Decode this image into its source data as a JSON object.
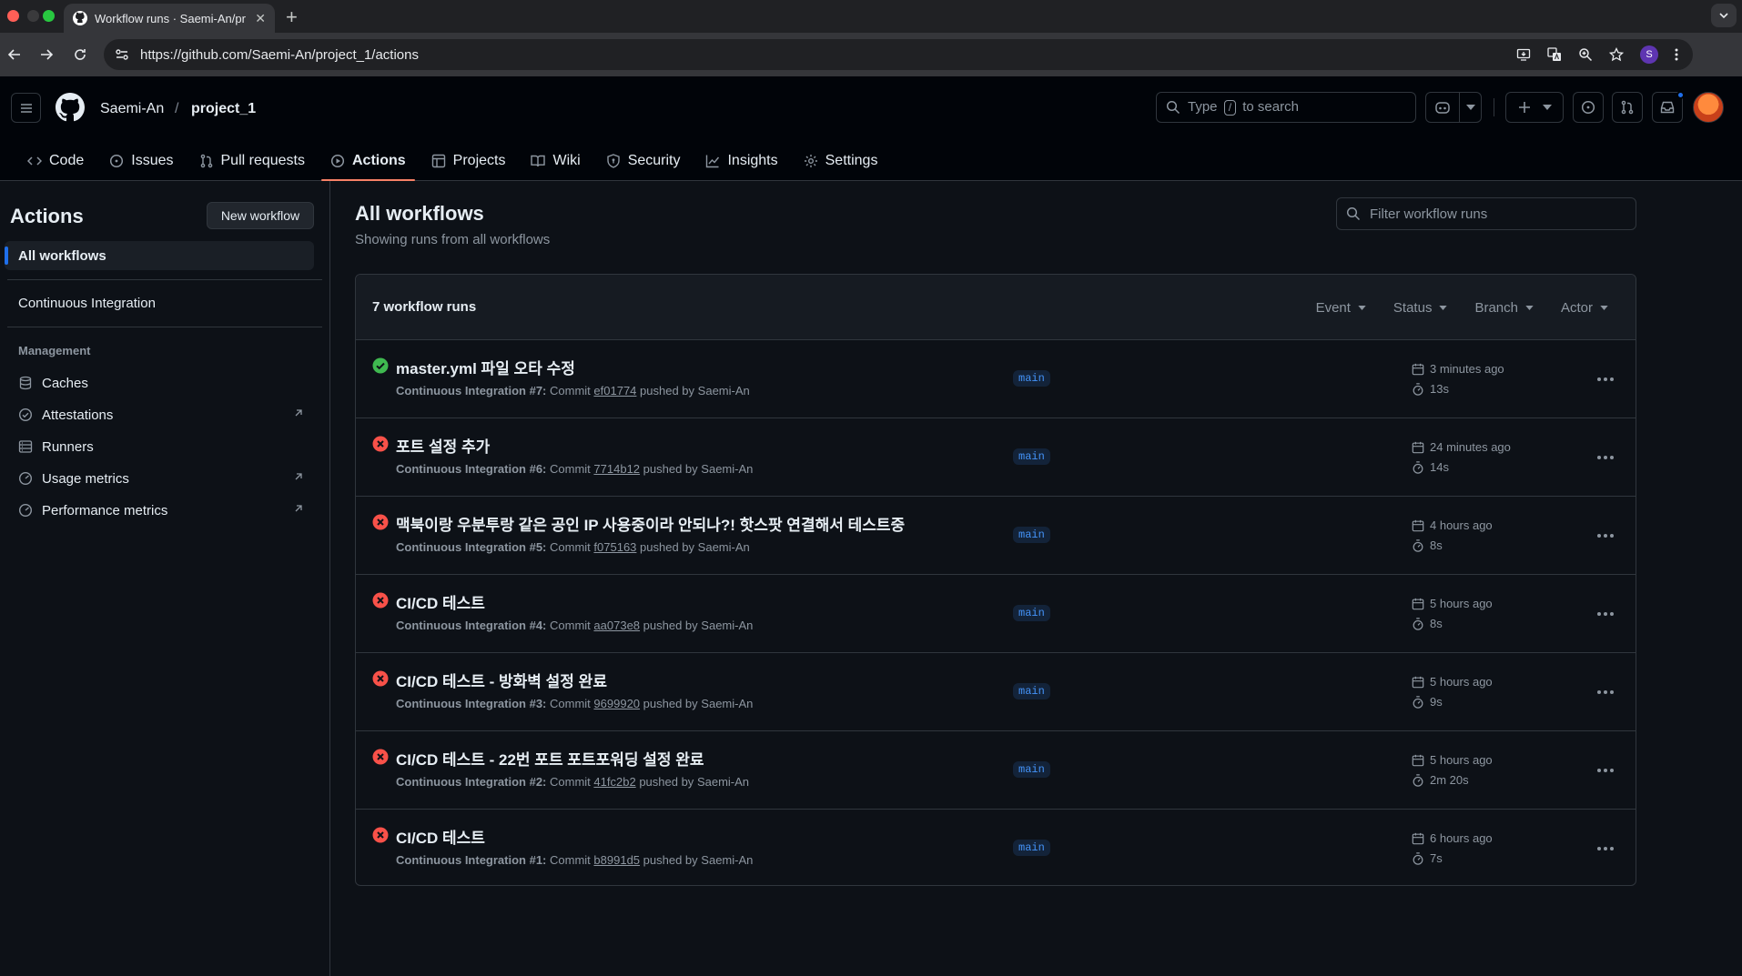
{
  "browser": {
    "tab_title": "Workflow runs · Saemi-An/pr",
    "url": "https://github.com/Saemi-An/project_1/actions",
    "profile_initial": "S"
  },
  "header": {
    "owner": "Saemi-An",
    "separator": "/",
    "repo": "project_1",
    "search_prefix": "Type",
    "search_key": "/",
    "search_suffix": "to search"
  },
  "repo_nav": [
    {
      "label": "Code",
      "icon": "code-icon"
    },
    {
      "label": "Issues",
      "icon": "issue-icon"
    },
    {
      "label": "Pull requests",
      "icon": "pull-request-icon"
    },
    {
      "label": "Actions",
      "icon": "play-icon",
      "active": true
    },
    {
      "label": "Projects",
      "icon": "table-icon"
    },
    {
      "label": "Wiki",
      "icon": "book-icon"
    },
    {
      "label": "Security",
      "icon": "shield-icon"
    },
    {
      "label": "Insights",
      "icon": "graph-icon"
    },
    {
      "label": "Settings",
      "icon": "gear-icon"
    }
  ],
  "sidebar": {
    "title": "Actions",
    "new_workflow_label": "New workflow",
    "all_workflows_label": "All workflows",
    "workflows": [
      "Continuous Integration"
    ],
    "management_label": "Management",
    "management_items": [
      {
        "label": "Caches",
        "icon": "database-icon",
        "external": false
      },
      {
        "label": "Attestations",
        "icon": "verified-icon",
        "external": true
      },
      {
        "label": "Runners",
        "icon": "server-icon",
        "external": false
      },
      {
        "label": "Usage metrics",
        "icon": "meter-icon",
        "external": true
      },
      {
        "label": "Performance metrics",
        "icon": "meter-icon",
        "external": true
      }
    ]
  },
  "main": {
    "title": "All workflows",
    "subtitle": "Showing runs from all workflows",
    "filter_placeholder": "Filter workflow runs",
    "runs_count": "7 workflow runs",
    "filters": [
      "Event",
      "Status",
      "Branch",
      "Actor"
    ],
    "commit_word": "Commit",
    "pushed_by_word": "pushed by"
  },
  "runs": [
    {
      "status": "success",
      "title": "master.yml 파일 오타 수정",
      "workflow": "Continuous Integration #7:",
      "sha": "ef01774",
      "actor": "Saemi-An",
      "branch": "main",
      "time": "3 minutes ago",
      "duration": "13s"
    },
    {
      "status": "failure",
      "title": "포트 설정 추가",
      "workflow": "Continuous Integration #6:",
      "sha": "7714b12",
      "actor": "Saemi-An",
      "branch": "main",
      "time": "24 minutes ago",
      "duration": "14s"
    },
    {
      "status": "failure",
      "title": "맥북이랑 우분투랑 같은 공인 IP 사용중이라 안되나?! 핫스팟 연결해서 테스트중",
      "workflow": "Continuous Integration #5:",
      "sha": "f075163",
      "actor": "Saemi-An",
      "branch": "main",
      "time": "4 hours ago",
      "duration": "8s"
    },
    {
      "status": "failure",
      "title": "CI/CD 테스트",
      "workflow": "Continuous Integration #4:",
      "sha": "aa073e8",
      "actor": "Saemi-An",
      "branch": "main",
      "time": "5 hours ago",
      "duration": "8s"
    },
    {
      "status": "failure",
      "title": "CI/CD 테스트 - 방화벽 설정 완료",
      "workflow": "Continuous Integration #3:",
      "sha": "9699920",
      "actor": "Saemi-An",
      "branch": "main",
      "time": "5 hours ago",
      "duration": "9s"
    },
    {
      "status": "failure",
      "title": "CI/CD 테스트 - 22번 포트 포트포워딩 설정 완료",
      "workflow": "Continuous Integration #2:",
      "sha": "41fc2b2",
      "actor": "Saemi-An",
      "branch": "main",
      "time": "5 hours ago",
      "duration": "2m 20s"
    },
    {
      "status": "failure",
      "title": "CI/CD 테스트",
      "workflow": "Continuous Integration #1:",
      "sha": "b8991d5",
      "actor": "Saemi-An",
      "branch": "main",
      "time": "6 hours ago",
      "duration": "7s"
    }
  ],
  "colors": {
    "success": "#3fb950",
    "failure": "#f85149",
    "accent": "#1f6feb",
    "active_tab": "#f78166"
  }
}
